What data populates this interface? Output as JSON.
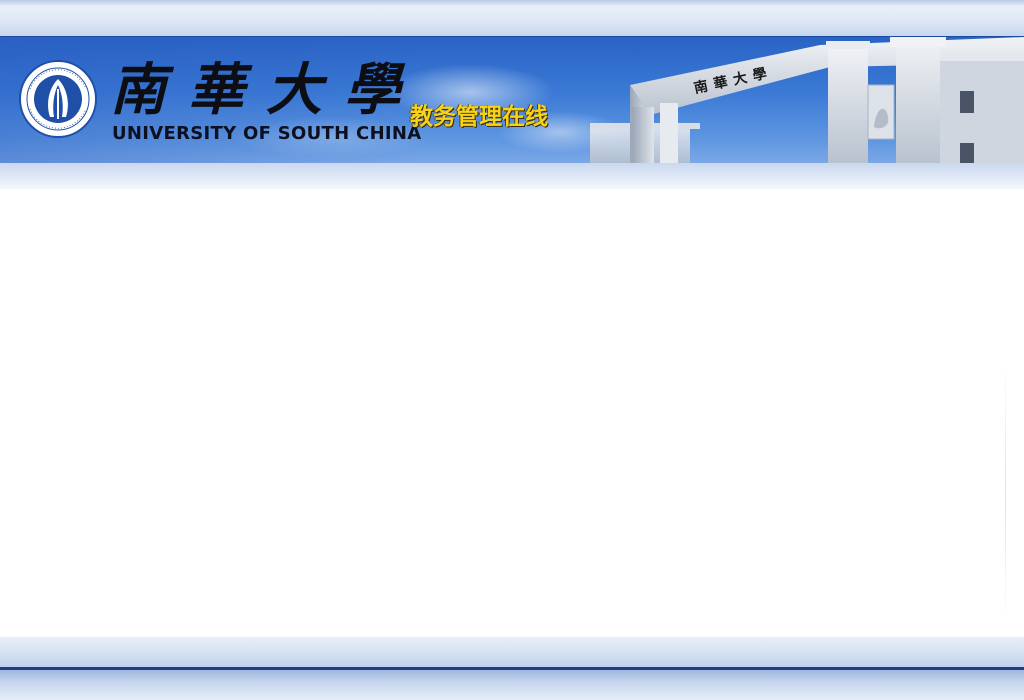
{
  "header": {
    "logo_name": "university-seal",
    "title_cn": "南華大學",
    "title_en": "UNIVERSITY OF SOUTH CHINA",
    "system_name": "教务管理在线",
    "gate_inscription": "南華大學"
  },
  "colors": {
    "banner_blue": "#3b7ad6",
    "system_name_yellow": "#f7d21a",
    "footer_line": "#1e3f84"
  }
}
